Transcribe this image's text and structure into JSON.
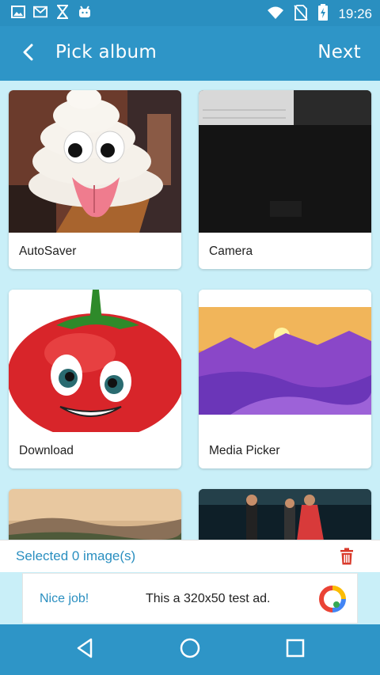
{
  "status_bar": {
    "time": "19:26",
    "left_icons": [
      "image-icon",
      "gmail-icon",
      "hourglass-icon",
      "android-icon"
    ],
    "right_icons": [
      "wifi-icon",
      "no-sim-icon",
      "battery-charging-icon"
    ]
  },
  "app_bar": {
    "title": "Pick album",
    "next_label": "Next"
  },
  "albums": [
    {
      "name": "AutoSaver"
    },
    {
      "name": "Camera"
    },
    {
      "name": "Download"
    },
    {
      "name": "Media Picker"
    },
    {
      "name": ""
    },
    {
      "name": ""
    }
  ],
  "selection": {
    "text": "Selected 0 image(s)"
  },
  "ad": {
    "nice": "Nice job!",
    "text": "This a 320x50 test ad."
  },
  "colors": {
    "primary": "#2e95c7",
    "background": "#c9eff8",
    "accent_text": "#2a8fc0",
    "trash": "#d93a2b"
  }
}
